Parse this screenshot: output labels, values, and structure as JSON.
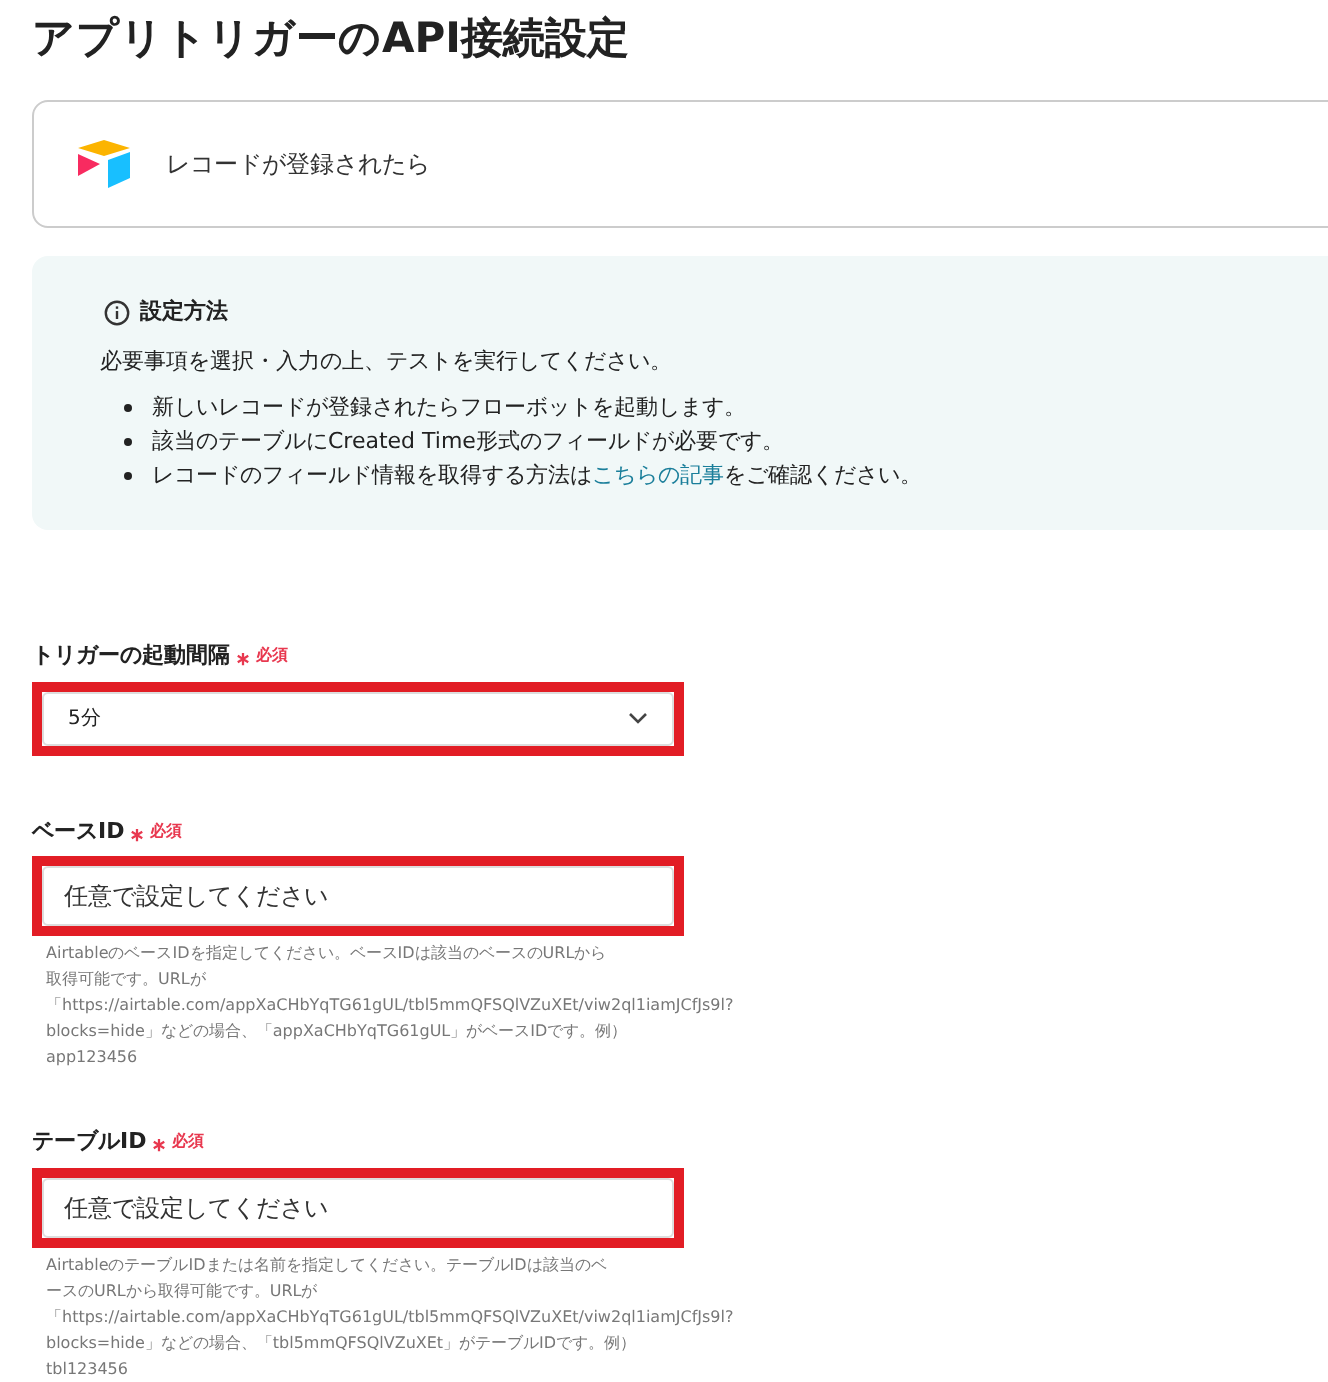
{
  "title": "アプリトリガーのAPI接続設定",
  "trigger_card": {
    "label": "レコードが登録されたら"
  },
  "info": {
    "heading": "設定方法",
    "intro": "必要事項を選択・入力の上、テストを実行してください。",
    "bullets": [
      "新しいレコードが登録されたらフローボットを起動します。",
      "該当のテーブルにCreated Time形式のフィールドが必要です。",
      {
        "before": "レコードのフィールド情報を取得する方法は",
        "link": "こちらの記事",
        "after": "をご確認ください。"
      }
    ]
  },
  "fields": [
    {
      "kind": "select",
      "label": "トリガーの起動間隔",
      "required": "必須",
      "value": "5分",
      "highlighted": true
    },
    {
      "kind": "input",
      "label": "ベースID",
      "required": "必須",
      "placeholder": "任意で設定してください",
      "highlighted": true,
      "help": [
        "AirtableのベースIDを指定してください。ベースIDは該当のベースのURLから",
        "取得可能です。URLが",
        "「https://airtable.com/appXaCHbYqTG61gUL/tbl5mmQFSQlVZuXEt/viw2ql1iamJCfJs9l?",
        "blocks=hide」などの場合、「appXaCHbYqTG61gUL」がベースIDです。例）",
        "app123456"
      ]
    },
    {
      "kind": "input",
      "label": "テーブルID",
      "required": "必須",
      "placeholder": "任意で設定してください",
      "highlighted": true,
      "help": [
        "AirtableのテーブルIDまたは名前を指定してください。テーブルIDは該当のベ",
        "ースのURLから取得可能です。URLが",
        "「https://airtable.com/appXaCHbYqTG61gUL/tbl5mmQFSQlVZuXEt/viw2ql1iamJCfJs9l?",
        "blocks=hide」などの場合、「tbl5mmQFSQlVZuXEt」がテーブルIDです。例）",
        "tbl123456"
      ]
    }
  ]
}
